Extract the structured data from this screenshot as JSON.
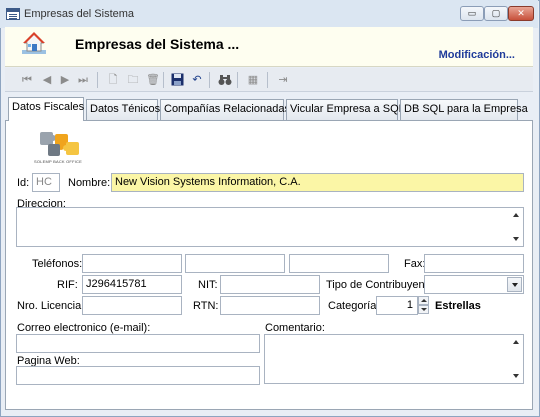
{
  "window": {
    "title": "Empresas del Sistema",
    "buttons": {
      "minimize": "▭",
      "maximize": "▢",
      "close": "✕"
    }
  },
  "header": {
    "title": "Empresas del Sistema ...",
    "mode": "Modificación..."
  },
  "toolbar": {
    "items": [
      "first-icon",
      "prev-icon",
      "next-icon",
      "last-icon",
      "new-doc-icon",
      "open-folder-icon",
      "delete-icon",
      "save-icon",
      "undo-icon",
      "find-icon",
      "grid-icon",
      "exit-icon"
    ],
    "glyphs": {
      "first": "⏮",
      "prev": "◀",
      "next": "▶",
      "last": "⏭",
      "new": "🗋",
      "open": "🗀",
      "delete": "🗑",
      "save": "💾",
      "undo": "↶",
      "find": "⚲",
      "grid": "▦",
      "exit": "⇥"
    }
  },
  "tabs": [
    "Datos Fiscales",
    "Datos Ténicos",
    "Compañías Relacionadas",
    "Vicular Empresa a SQL",
    "DB SQL para la Empresa"
  ],
  "logo": {
    "caption": "SOLEMP BACK OFFICE"
  },
  "form": {
    "id_label": "Id:",
    "id_value": "HC",
    "nombre_label": "Nombre:",
    "nombre_value": "New Vision Systems Information, C.A.",
    "direccion_label": "Direccion:",
    "direccion_value": "",
    "telefonos_label": "Teléfonos:",
    "fax_label": "Fax:",
    "rif_label": "RIF:",
    "rif_value": "J296415781",
    "nit_label": "NIT:",
    "nit_value": "",
    "tipo_contribuyente_label": "Tipo de Contribuyente",
    "tipo_contribuyente_value": "",
    "licencia_label": "Nro. Licencia:",
    "rtn_label": "RTN:",
    "categoria_label": "Categoría:",
    "categoria_value": "1",
    "estrellas_label": "Estrellas",
    "correo_label": "Correo electronico (e-mail):",
    "comentario_label": "Comentario:",
    "pagina_label": "Pagina Web:"
  }
}
